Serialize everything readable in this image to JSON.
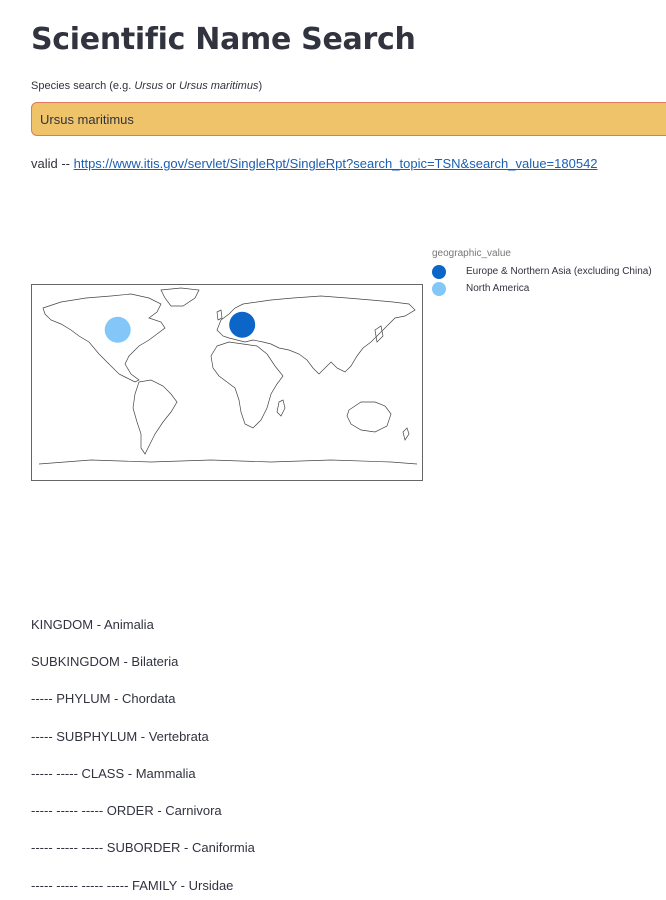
{
  "page": {
    "title": "Scientific Name Search"
  },
  "search": {
    "label_prefix": "Species search (e.g. ",
    "label_example1": "Ursus",
    "label_middle": " or ",
    "label_example2": "Ursus maritimus",
    "label_suffix": ")",
    "value": "Ursus maritimus"
  },
  "result": {
    "status": "valid -- ",
    "link_text": "https://www.itis.gov/servlet/SingleRpt/SingleRpt?search_topic=TSN&search_value=180542"
  },
  "map": {
    "legend_title": "geographic_value",
    "points": [
      {
        "label": "Europe & Northern Asia (excluding China)",
        "color": "#0b66c8",
        "lon": 15,
        "lat": 50
      },
      {
        "label": "North America",
        "color": "#83c7f8",
        "lon": -100,
        "lat": 45
      }
    ]
  },
  "taxonomy": [
    "KINGDOM - Animalia",
    "SUBKINGDOM - Bilateria",
    "----- PHYLUM - Chordata",
    "----- SUBPHYLUM - Vertebrata",
    "----- ----- CLASS - Mammalia",
    "----- ----- ----- ORDER - Carnivora",
    "----- ----- ----- SUBORDER - Caniformia",
    "----- ----- ----- ----- FAMILY - Ursidae"
  ]
}
